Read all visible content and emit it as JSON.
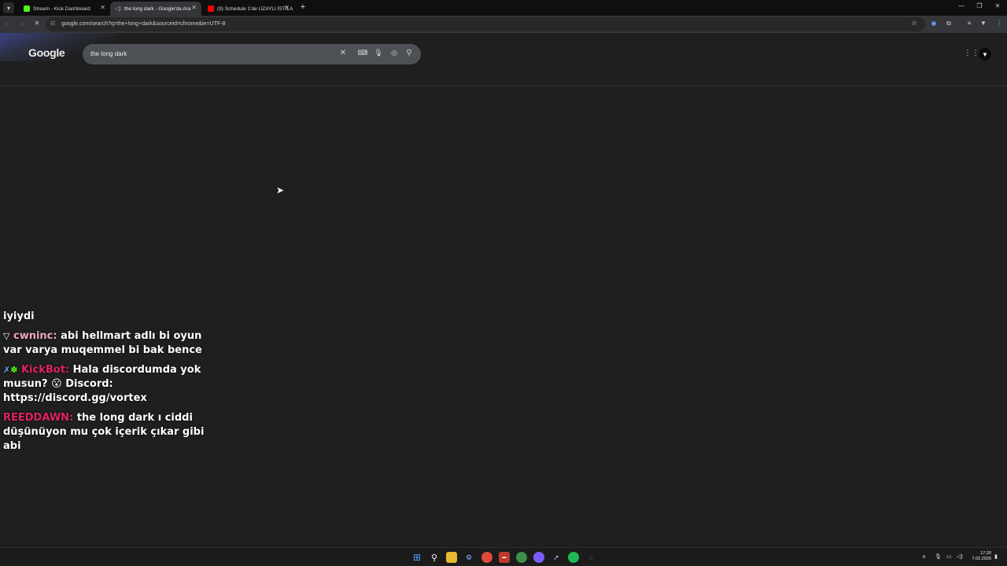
{
  "browser": {
    "tabs": [
      {
        "title": "Stream - Kick Dashboard",
        "favicon_color": "#53fc18",
        "active": false
      },
      {
        "title": "the long dark - Google'da Ara",
        "favicon_color": "#888888",
        "active": true
      },
      {
        "title": "(9) Schedule 1'de UZAYLI İSTİLA",
        "favicon_color": "#ff0000",
        "active": false
      }
    ],
    "url": "google.com/search?q=the+long+dark&sourceid=chrome&ie=UTF-8"
  },
  "google": {
    "logo": "Google",
    "query": "the long dark"
  },
  "chat": {
    "messages": [
      {
        "user": "",
        "text": "iyiydi"
      },
      {
        "user": "cwninc:",
        "text": "abi hellmart adlı bi oyun var varya muqemmel bi bak bence"
      },
      {
        "user": "KickBot:",
        "text": "Hala discordumda yok musun? 😮 Discord: https://discord.gg/vortex"
      },
      {
        "user": "REEDDAWN:",
        "text": "the long dark ı ciddi düşünüyon mu çok içerik çıkar gibi abi"
      }
    ]
  },
  "taskbar": {
    "time": "17:20",
    "date": "7.02.2026"
  },
  "icons": {
    "search": "search-icon",
    "mic": "mic-icon",
    "lens": "lens-icon",
    "keyboard": "keyboard-icon",
    "clear": "close-icon"
  }
}
